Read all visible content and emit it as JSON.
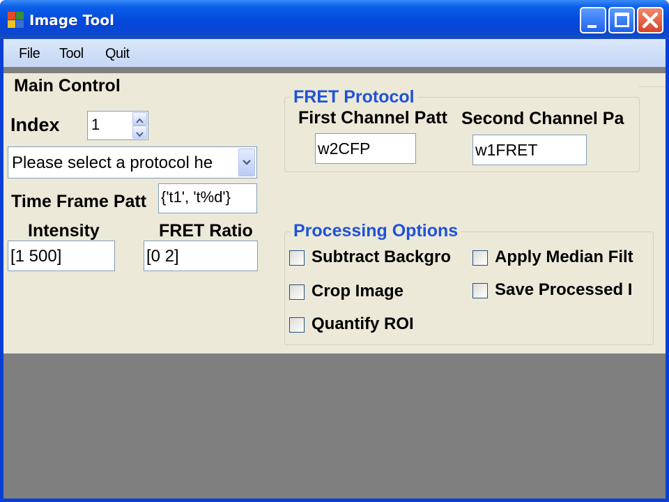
{
  "window": {
    "title": "Image Tool"
  },
  "menu": {
    "items": [
      "File",
      "Tool",
      "Quit"
    ]
  },
  "main_control": {
    "legend": "Main Control",
    "index_label": "Index",
    "index_value": "1",
    "protocol_select_value": "Please select a protocol he",
    "time_frame_label": "Time Frame Patt",
    "time_frame_value": "{'t1', 't%d'}",
    "intensity_label": "Intensity",
    "intensity_value": "[1 500]",
    "fret_ratio_label": "FRET Ratio",
    "fret_ratio_value": "[0 2]"
  },
  "fret_protocol": {
    "legend": "FRET Protocol",
    "first_channel_label": "First Channel Patt",
    "first_channel_value": "w2CFP",
    "second_channel_label": "Second Channel Pa",
    "second_channel_value": "w1FRET"
  },
  "processing_options": {
    "legend": "Processing Options",
    "options": [
      {
        "label": "Subtract Backgro",
        "checked": false
      },
      {
        "label": "Apply Median Filt",
        "checked": false
      },
      {
        "label": "Crop Image",
        "checked": false
      },
      {
        "label": "Save Processed I",
        "checked": false
      },
      {
        "label": "Quantify ROI",
        "checked": false
      }
    ]
  },
  "colors": {
    "titlebar": "#0548dc",
    "client_background": "#ece9d8",
    "group_heading_blue": "#1f52d6"
  }
}
